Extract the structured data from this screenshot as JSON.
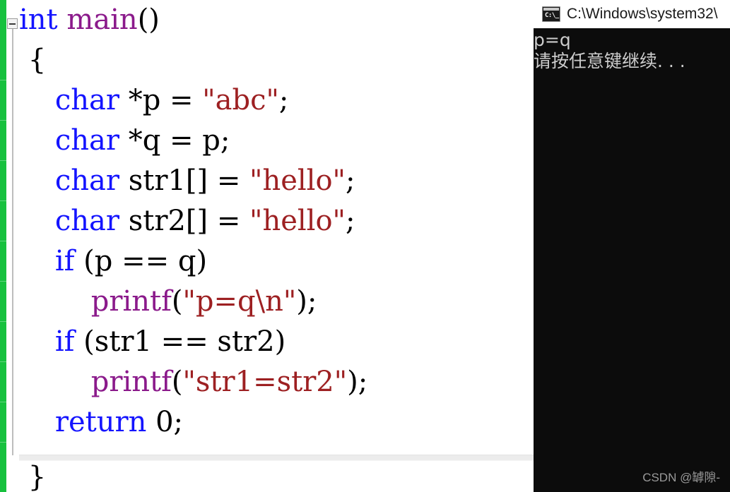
{
  "editor": {
    "fold_marker": "−",
    "change_indicator_color": "#17c13e",
    "colors": {
      "keyword": "#1414ff",
      "function": "#8b1a8b",
      "string": "#9d2022",
      "plain": "#000000"
    },
    "lines": [
      {
        "indent": 0,
        "tokens": [
          {
            "t": "int",
            "c": "kw"
          },
          {
            "t": " ",
            "c": "pl"
          },
          {
            "t": "main",
            "c": "fn"
          },
          {
            "t": "()",
            "c": "pl"
          }
        ]
      },
      {
        "indent": 0,
        "tokens": [
          {
            "t": " {",
            "c": "pl"
          }
        ]
      },
      {
        "indent": 0,
        "tokens": [
          {
            "t": "    ",
            "c": "pl"
          },
          {
            "t": "char",
            "c": "kw"
          },
          {
            "t": " *p = ",
            "c": "pl"
          },
          {
            "t": "\"abc\"",
            "c": "str"
          },
          {
            "t": ";",
            "c": "pl"
          }
        ]
      },
      {
        "indent": 0,
        "tokens": [
          {
            "t": "    ",
            "c": "pl"
          },
          {
            "t": "char",
            "c": "kw"
          },
          {
            "t": " *q = p;",
            "c": "pl"
          }
        ]
      },
      {
        "indent": 0,
        "tokens": [
          {
            "t": "    ",
            "c": "pl"
          },
          {
            "t": "char",
            "c": "kw"
          },
          {
            "t": " str1[] = ",
            "c": "pl"
          },
          {
            "t": "\"hello\"",
            "c": "str"
          },
          {
            "t": ";",
            "c": "pl"
          }
        ]
      },
      {
        "indent": 0,
        "tokens": [
          {
            "t": "    ",
            "c": "pl"
          },
          {
            "t": "char",
            "c": "kw"
          },
          {
            "t": " str2[] = ",
            "c": "pl"
          },
          {
            "t": "\"hello\"",
            "c": "str"
          },
          {
            "t": ";",
            "c": "pl"
          }
        ]
      },
      {
        "indent": 0,
        "tokens": [
          {
            "t": "    ",
            "c": "pl"
          },
          {
            "t": "if",
            "c": "kw"
          },
          {
            "t": " (p == q)",
            "c": "pl"
          }
        ]
      },
      {
        "indent": 0,
        "tokens": [
          {
            "t": "        ",
            "c": "pl"
          },
          {
            "t": "printf",
            "c": "fn"
          },
          {
            "t": "(",
            "c": "pl"
          },
          {
            "t": "\"p=q\\n\"",
            "c": "str"
          },
          {
            "t": ");",
            "c": "pl"
          }
        ]
      },
      {
        "indent": 0,
        "tokens": [
          {
            "t": "    ",
            "c": "pl"
          },
          {
            "t": "if",
            "c": "kw"
          },
          {
            "t": " (str1 == str2)",
            "c": "pl"
          }
        ]
      },
      {
        "indent": 0,
        "tokens": [
          {
            "t": "        ",
            "c": "pl"
          },
          {
            "t": "printf",
            "c": "fn"
          },
          {
            "t": "(",
            "c": "pl"
          },
          {
            "t": "\"str1=str2\"",
            "c": "str"
          },
          {
            "t": ");",
            "c": "pl"
          }
        ]
      },
      {
        "indent": 0,
        "tokens": [
          {
            "t": "    ",
            "c": "pl"
          },
          {
            "t": "return",
            "c": "kw"
          },
          {
            "t": " 0;",
            "c": "pl"
          }
        ]
      }
    ],
    "closing_line": " }"
  },
  "console": {
    "icon": "cmd-icon",
    "icon_prompt": "C:\\_",
    "title": "C:\\Windows\\system32\\",
    "output_lines": [
      "p=q",
      "请按任意键继续. . ."
    ],
    "background_color": "#0c0c0c",
    "text_color": "#cccccc"
  },
  "watermark": {
    "text": "CSDN @罅隙-"
  }
}
